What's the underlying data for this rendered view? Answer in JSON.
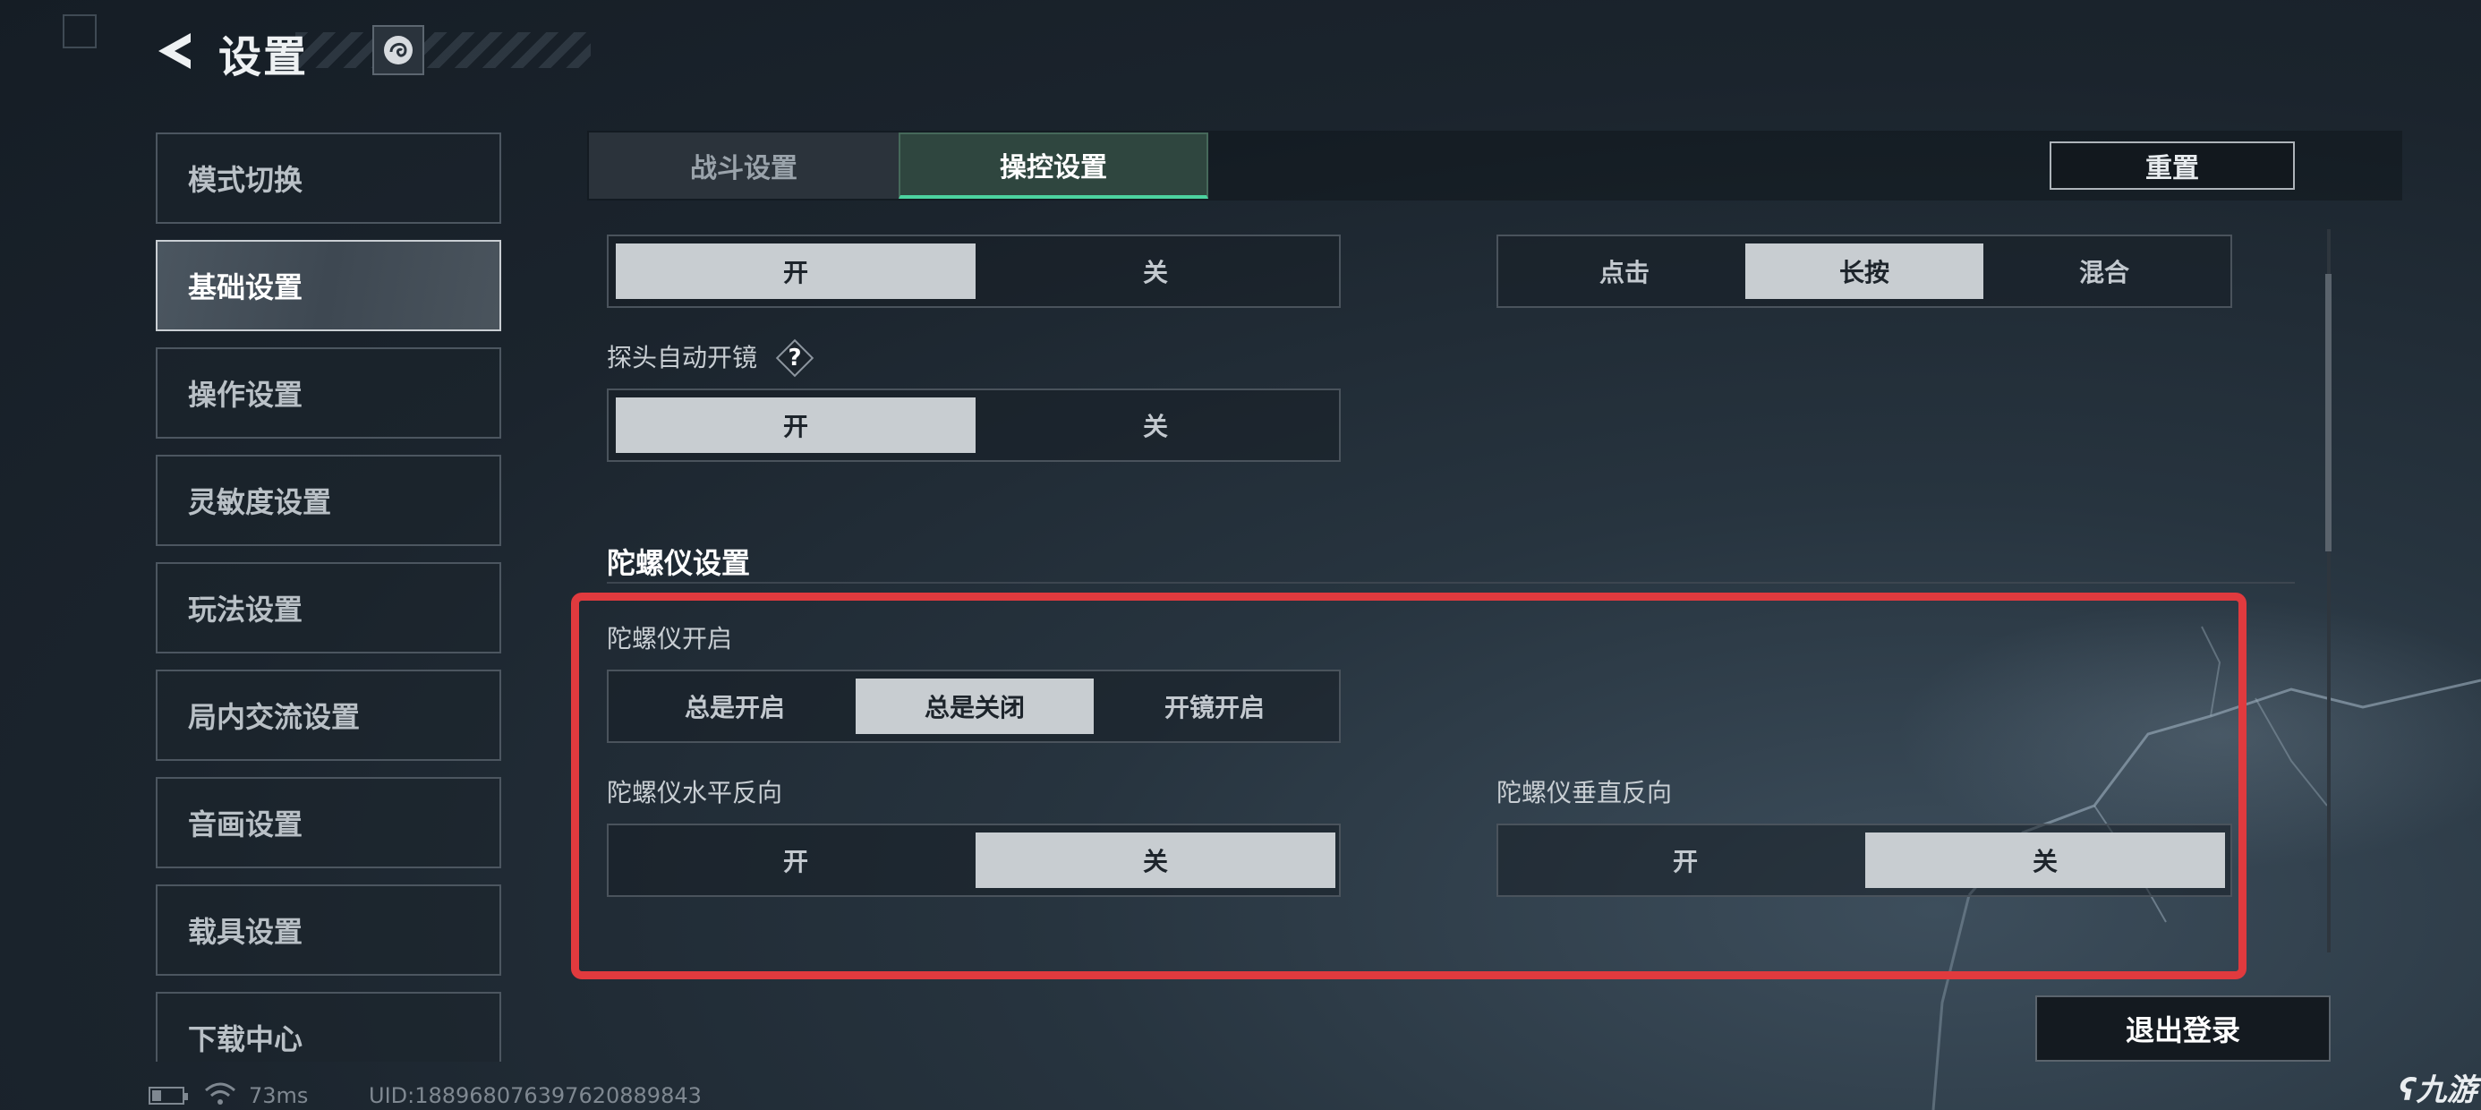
{
  "header": {
    "title": "设置"
  },
  "sidebar": {
    "items": [
      {
        "label": "模式切换"
      },
      {
        "label": "基础设置"
      },
      {
        "label": "操作设置"
      },
      {
        "label": "灵敏度设置"
      },
      {
        "label": "玩法设置"
      },
      {
        "label": "局内交流设置"
      },
      {
        "label": "音画设置"
      },
      {
        "label": "载具设置"
      },
      {
        "label": "下载中心"
      }
    ],
    "active_index": 1
  },
  "tabs": [
    {
      "label": "战斗设置",
      "active": false
    },
    {
      "label": "操控设置",
      "active": true
    }
  ],
  "reset_label": "重置",
  "settings": {
    "row1_left": {
      "options": [
        "开",
        "关"
      ],
      "selected": "开"
    },
    "row1_right": {
      "options": [
        "点击",
        "长按",
        "混合"
      ],
      "selected": "长按"
    },
    "probe_auto_scope": {
      "label": "探头自动开镜",
      "options": [
        "开",
        "关"
      ],
      "selected": "开"
    }
  },
  "gyro": {
    "section_title": "陀螺仪设置",
    "enable": {
      "label": "陀螺仪开启",
      "options": [
        "总是开启",
        "总是关闭",
        "开镜开启"
      ],
      "selected": "总是关闭"
    },
    "horizontal_invert": {
      "label": "陀螺仪水平反向",
      "options": [
        "开",
        "关"
      ],
      "selected": "关"
    },
    "vertical_invert": {
      "label": "陀螺仪垂直反向",
      "options": [
        "开",
        "关"
      ],
      "selected": "关"
    }
  },
  "logout_label": "退出登录",
  "status_bar": {
    "ping": "73ms",
    "uid": "UID:1889680763976208898​43"
  },
  "watermark": "九游",
  "colors": {
    "highlight": "#e03a3e",
    "tab_active_underline": "#4cd3a0",
    "selected_option": "#c8cdd1"
  }
}
